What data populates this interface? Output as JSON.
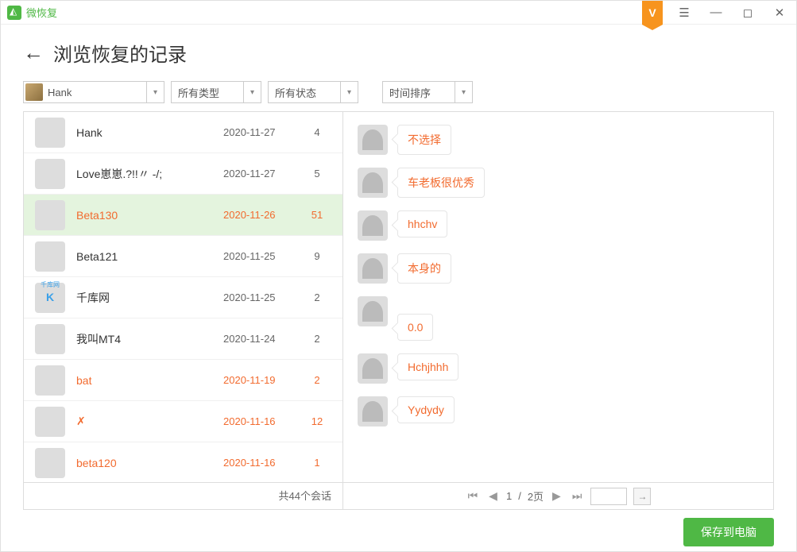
{
  "app": {
    "name": "微恢复",
    "vip": "V"
  },
  "header": {
    "title": "浏览恢复的记录"
  },
  "filters": {
    "user": "Hank",
    "type": "所有类型",
    "status": "所有状态",
    "sort": "时间排序"
  },
  "rows": [
    {
      "name": "Hank",
      "date": "2020-11-27",
      "count": "4",
      "deleted": false,
      "avatar": 0
    },
    {
      "name": "Love崽崽.?!!〃 -/;",
      "date": "2020-11-27",
      "count": "5",
      "deleted": false,
      "avatar": 1
    },
    {
      "name": "Beta130",
      "date": "2020-11-26",
      "count": "51",
      "deleted": true,
      "selected": true,
      "avatar": 2
    },
    {
      "name": "Beta121",
      "date": "2020-11-25",
      "count": "9",
      "deleted": false,
      "avatar": 3
    },
    {
      "name": "千库网",
      "date": "2020-11-25",
      "count": "2",
      "deleted": false,
      "avatar": 4
    },
    {
      "name": "我叫MT4",
      "date": "2020-11-24",
      "count": "2",
      "deleted": false,
      "avatar": 5
    },
    {
      "name": "bat",
      "date": "2020-11-19",
      "count": "2",
      "deleted": true,
      "avatar": 6
    },
    {
      "name": "✗",
      "date": "2020-11-16",
      "count": "12",
      "deleted": true,
      "avatar": 7
    },
    {
      "name": "beta120",
      "date": "2020-11-16",
      "count": "1",
      "deleted": true,
      "avatar": 8
    }
  ],
  "contacts": [
    {
      "label": "不选择",
      "offset": false
    },
    {
      "label": "车老板很优秀",
      "offset": false
    },
    {
      "label": "hhchv",
      "offset": false
    },
    {
      "label": "本身的",
      "offset": false
    },
    {
      "label": "0.0",
      "offset": true
    },
    {
      "label": "Hchjhhh",
      "offset": false
    },
    {
      "label": "Yydydy",
      "offset": false
    }
  ],
  "footer": {
    "total": "共44个会话",
    "page_current": "1",
    "page_sep": " / ",
    "page_total": "2页"
  },
  "save": {
    "label": "保存到电脑"
  }
}
